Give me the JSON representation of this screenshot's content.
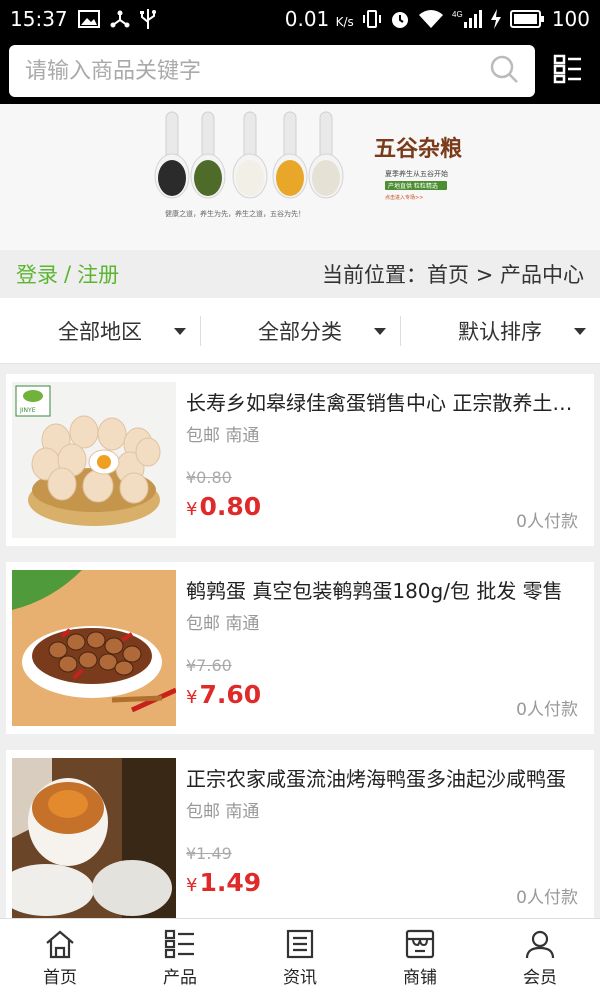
{
  "status_bar": {
    "time": "15:37",
    "speed": "0.01",
    "speed_unit": "K/s",
    "network": "4G",
    "battery": "100"
  },
  "search": {
    "placeholder": "请输入商品关键字"
  },
  "banner": {
    "brand_text": "五谷杂粮",
    "tagline": "夏季养生从五谷开始",
    "slogan": "健康之道，养生为先，养生之道，五谷为先！",
    "badge": "产地直供 粒粒精选",
    "link_hint": "点击进入专场>>"
  },
  "nav": {
    "login": "登录",
    "sep": "/",
    "register": "注册",
    "breadcrumb": "当前位置：首页 > 产品中心"
  },
  "filters": [
    {
      "label": "全部地区"
    },
    {
      "label": "全部分类"
    },
    {
      "label": "默认排序"
    }
  ],
  "products": [
    {
      "title": "长寿乡如皋绿佳禽蛋销售中心 正宗散养土鸡蛋",
      "tags": "包邮 南通",
      "old_price": "¥0.80",
      "currency": "¥",
      "price": "0.80",
      "sold": "0人付款",
      "image_logo": "JINYE"
    },
    {
      "title": "鹌鹑蛋 真空包装鹌鹑蛋180g/包 批发 零售",
      "tags": "包邮 南通",
      "old_price": "¥7.60",
      "currency": "¥",
      "price": "7.60",
      "sold": "0人付款"
    },
    {
      "title": "正宗农家咸蛋流油烤海鸭蛋多油起沙咸鸭蛋",
      "tags": "包邮 南通",
      "old_price": "¥1.49",
      "currency": "¥",
      "price": "1.49",
      "sold": "0人付款"
    }
  ],
  "tabbar": [
    {
      "label": "首页",
      "icon": "home-icon"
    },
    {
      "label": "产品",
      "icon": "list-icon"
    },
    {
      "label": "资讯",
      "icon": "news-icon"
    },
    {
      "label": "商铺",
      "icon": "store-icon"
    },
    {
      "label": "会员",
      "icon": "user-icon"
    }
  ],
  "colors": {
    "accent_green": "#5cb531",
    "price_red": "#e02a2a",
    "top_bar": "#000000"
  }
}
